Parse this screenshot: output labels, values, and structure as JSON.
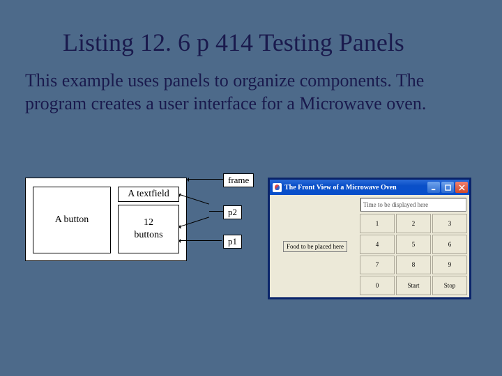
{
  "title": "Listing 12. 6 p 414 Testing Panels",
  "body": "This example uses panels to organize components. The program creates a user interface for a Microwave oven.",
  "schematic": {
    "button_label": "A button",
    "textfield_label": "A textfield",
    "buttons12_label": "12\nbuttons",
    "callouts": {
      "frame": "frame",
      "p2": "p2",
      "p1": "p1"
    }
  },
  "window": {
    "title": "The Front View of a Microwave Oven",
    "food_label": "Food to be placed here",
    "time_text": "Time to be displayed here",
    "keys": [
      "1",
      "2",
      "3",
      "4",
      "5",
      "6",
      "7",
      "8",
      "9",
      "0",
      "Start",
      "Stop"
    ]
  }
}
